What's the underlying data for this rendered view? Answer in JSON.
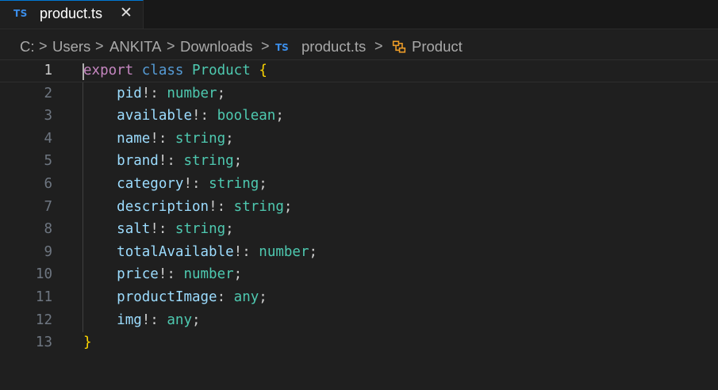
{
  "tab": {
    "icon_text": "TS",
    "label": "product.ts",
    "close_glyph": "✕"
  },
  "breadcrumb": {
    "items": [
      "C:",
      "Users",
      "ANKITA",
      "Downloads",
      "product.ts",
      "Product"
    ],
    "separator": ">",
    "file_icon_text": "TS",
    "class_icon": "symbol-class-icon"
  },
  "editor": {
    "active_line": 1,
    "lines": [
      {
        "n": "1",
        "tokens": [
          [
            "kw",
            "export"
          ],
          [
            "punc",
            " "
          ],
          [
            "kw2",
            "class"
          ],
          [
            "punc",
            " "
          ],
          [
            "cls",
            "Product"
          ],
          [
            "punc",
            " "
          ],
          [
            "brace",
            "{"
          ]
        ]
      },
      {
        "n": "2",
        "tokens": [
          [
            "punc",
            "    "
          ],
          [
            "prop",
            "pid"
          ],
          [
            "punc",
            "!: "
          ],
          [
            "type",
            "number"
          ],
          [
            "punc",
            ";"
          ]
        ]
      },
      {
        "n": "3",
        "tokens": [
          [
            "punc",
            "    "
          ],
          [
            "prop",
            "available"
          ],
          [
            "punc",
            "!: "
          ],
          [
            "type",
            "boolean"
          ],
          [
            "punc",
            ";"
          ]
        ]
      },
      {
        "n": "4",
        "tokens": [
          [
            "punc",
            "    "
          ],
          [
            "prop",
            "name"
          ],
          [
            "punc",
            "!: "
          ],
          [
            "type",
            "string"
          ],
          [
            "punc",
            ";"
          ]
        ]
      },
      {
        "n": "5",
        "tokens": [
          [
            "punc",
            "    "
          ],
          [
            "prop",
            "brand"
          ],
          [
            "punc",
            "!: "
          ],
          [
            "type",
            "string"
          ],
          [
            "punc",
            ";"
          ]
        ]
      },
      {
        "n": "6",
        "tokens": [
          [
            "punc",
            "    "
          ],
          [
            "prop",
            "category"
          ],
          [
            "punc",
            "!: "
          ],
          [
            "type",
            "string"
          ],
          [
            "punc",
            ";"
          ]
        ]
      },
      {
        "n": "7",
        "tokens": [
          [
            "punc",
            "    "
          ],
          [
            "prop",
            "description"
          ],
          [
            "punc",
            "!: "
          ],
          [
            "type",
            "string"
          ],
          [
            "punc",
            ";"
          ]
        ]
      },
      {
        "n": "8",
        "tokens": [
          [
            "punc",
            "    "
          ],
          [
            "prop",
            "salt"
          ],
          [
            "punc",
            "!: "
          ],
          [
            "type",
            "string"
          ],
          [
            "punc",
            ";"
          ]
        ]
      },
      {
        "n": "9",
        "tokens": [
          [
            "punc",
            "    "
          ],
          [
            "prop",
            "totalAvailable"
          ],
          [
            "punc",
            "!: "
          ],
          [
            "type",
            "number"
          ],
          [
            "punc",
            ";"
          ]
        ]
      },
      {
        "n": "10",
        "tokens": [
          [
            "punc",
            "    "
          ],
          [
            "prop",
            "price"
          ],
          [
            "punc",
            "!: "
          ],
          [
            "type",
            "number"
          ],
          [
            "punc",
            ";"
          ]
        ]
      },
      {
        "n": "11",
        "tokens": [
          [
            "punc",
            "    "
          ],
          [
            "prop",
            "productImage"
          ],
          [
            "punc",
            ": "
          ],
          [
            "type",
            "any"
          ],
          [
            "punc",
            ";"
          ]
        ]
      },
      {
        "n": "12",
        "tokens": [
          [
            "punc",
            "    "
          ],
          [
            "prop",
            "img"
          ],
          [
            "punc",
            "!: "
          ],
          [
            "type",
            "any"
          ],
          [
            "punc",
            ";"
          ]
        ]
      },
      {
        "n": "13",
        "tokens": [
          [
            "brace",
            "}"
          ]
        ]
      }
    ]
  },
  "colors": {
    "background": "#1f1f1f",
    "tabbar": "#181818",
    "keyword": "#c586c0",
    "storage": "#569cd6",
    "class_type": "#4ec9b0",
    "property": "#9cdcfe",
    "brace": "#ffd700",
    "ts_icon": "#3b8eea",
    "breadcrumb_class_icon": "#ee9d28"
  }
}
